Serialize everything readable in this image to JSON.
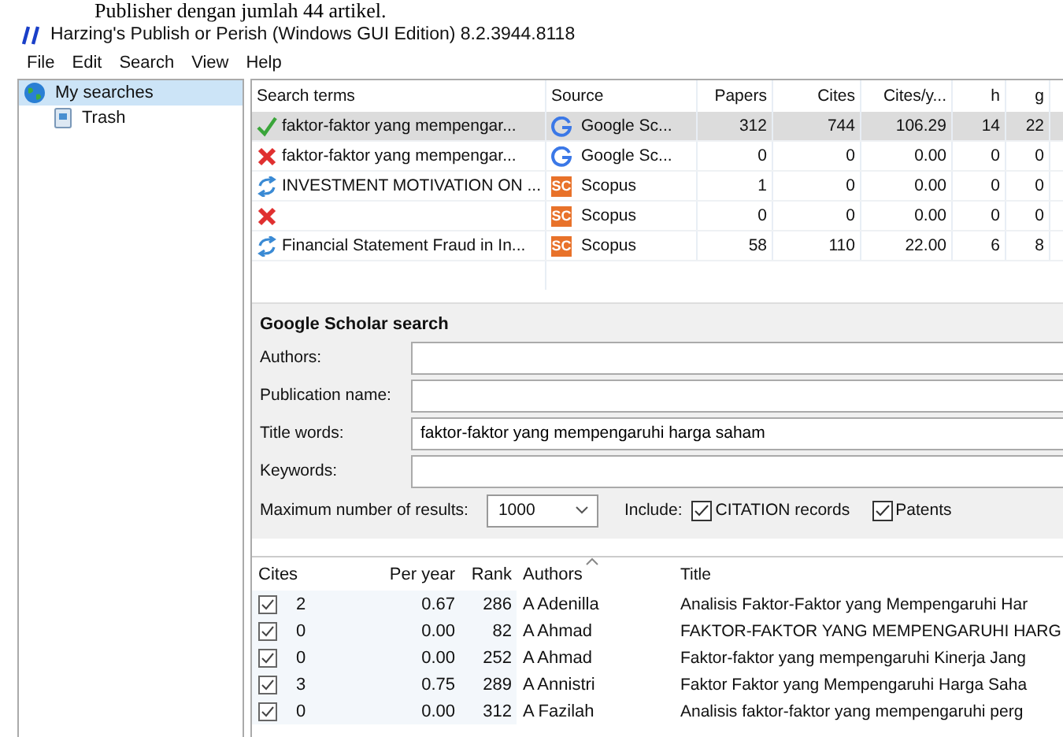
{
  "document_caption": "Publisher dengan jumlah 44 artikel.",
  "window": {
    "title": "Harzing's Publish or Perish (Windows GUI Edition) 8.2.3944.8118"
  },
  "menu": [
    "File",
    "Edit",
    "Search",
    "View",
    "Help"
  ],
  "sidebar": {
    "items": [
      {
        "kind": "globe",
        "label": "My searches",
        "selected": true
      },
      {
        "kind": "trash",
        "label": "Trash",
        "selected": false
      }
    ]
  },
  "searches": {
    "columns": [
      "Search terms",
      "Source",
      "Papers",
      "Cites",
      "Cites/y...",
      "h",
      "g"
    ],
    "rows": [
      {
        "kind": "done",
        "term": "faktor-faktor yang mempengar...",
        "source": "Google Sc...",
        "papers": "312",
        "cites": "744",
        "cites_per_year": "106.29",
        "h": "14",
        "g": "22",
        "selected": true
      },
      {
        "kind": "error",
        "term": "faktor-faktor yang mempengar...",
        "source": "Google Sc...",
        "papers": "0",
        "cites": "0",
        "cites_per_year": "0.00",
        "h": "0",
        "g": "0",
        "selected": false
      },
      {
        "kind": "refresh",
        "term": "INVESTMENT MOTIVATION ON ...",
        "source_badge": "SC",
        "source": "Scopus",
        "papers": "1",
        "cites": "0",
        "cites_per_year": "0.00",
        "h": "0",
        "g": "0",
        "selected": false
      },
      {
        "kind": "error",
        "source_badge": "SC",
        "source": "Scopus",
        "papers": "0",
        "cites": "0",
        "cites_per_year": "0.00",
        "h": "0",
        "g": "0",
        "selected": false
      },
      {
        "kind": "refresh",
        "term": "Financial Statement Fraud in In...",
        "source_badge": "SC",
        "source": "Scopus",
        "papers": "58",
        "cites": "110",
        "cites_per_year": "22.00",
        "h": "6",
        "g": "8",
        "selected": false
      }
    ]
  },
  "search_form": {
    "title": "Google Scholar search",
    "fields": [
      {
        "label": "Authors:"
      },
      {
        "label": "Publication name:"
      },
      {
        "label": "Title words:",
        "value": "faktor-faktor yang mempengaruhi harga saham"
      },
      {
        "label": "Keywords:"
      }
    ],
    "max_results": {
      "label": "Maximum number of results:",
      "value": "1000"
    },
    "include": {
      "label": "Include:",
      "options": [
        {
          "label": "CITATION records",
          "checked": true
        },
        {
          "label": "Patents",
          "checked": true
        }
      ]
    }
  },
  "results": {
    "columns": [
      "Cites",
      "Per year",
      "Rank",
      "Authors",
      "Title"
    ],
    "rows": [
      {
        "checked": true,
        "cites": "2",
        "per_year": "0.67",
        "rank": "286",
        "authors": "A Adenilla",
        "title": "Analisis Faktor-Faktor yang Mempengaruhi Har"
      },
      {
        "checked": true,
        "cites": "0",
        "per_year": "0.00",
        "rank": "82",
        "authors": "A Ahmad",
        "title": "FAKTOR-FAKTOR YANG MEMPENGARUHI HARG"
      },
      {
        "checked": true,
        "cites": "0",
        "per_year": "0.00",
        "rank": "252",
        "authors": "A Ahmad",
        "title": "Faktor-faktor yang mempengaruhi Kinerja Jang"
      },
      {
        "checked": true,
        "cites": "3",
        "per_year": "0.75",
        "rank": "289",
        "authors": "A Annistri",
        "title": "Faktor Faktor yang Mempengaruhi Harga Saha"
      },
      {
        "checked": true,
        "cites": "0",
        "per_year": "0.00",
        "rank": "312",
        "authors": "A Fazilah",
        "title": "Analisis faktor-faktor yang mempengaruhi perg"
      }
    ]
  }
}
